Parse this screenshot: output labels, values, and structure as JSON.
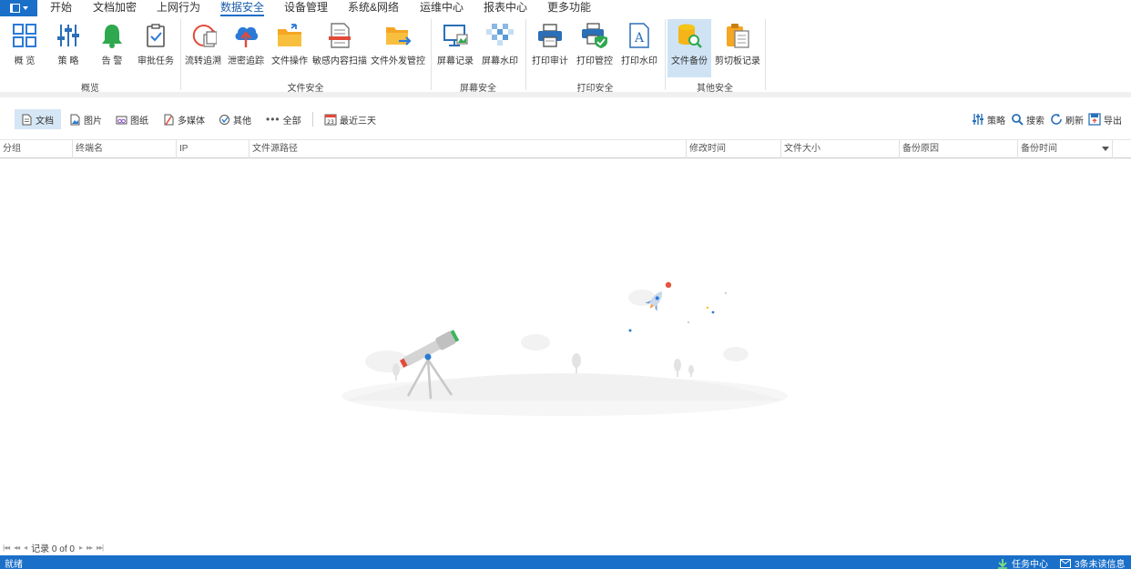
{
  "menubar": {
    "items": [
      "开始",
      "文档加密",
      "上网行为",
      "数据安全",
      "设备管理",
      "系统&网络",
      "运维中心",
      "报表中心",
      "更多功能"
    ],
    "active_index": 3
  },
  "ribbon": {
    "buttons": [
      "概 览",
      "策 略",
      "告 警",
      "审批任务",
      "流转追溯",
      "泄密追踪",
      "文件操作",
      "敏感内容扫描",
      "文件外发管控",
      "屏幕记录",
      "屏幕水印",
      "打印审计",
      "打印管控",
      "打印水印",
      "文件备份",
      "剪切板记录"
    ],
    "selected_index": 14,
    "groups": [
      "概览",
      "文件安全",
      "屏幕安全",
      "打印安全",
      "其他安全"
    ]
  },
  "filters": {
    "left": [
      "文档",
      "图片",
      "图纸",
      "多媒体",
      "其他",
      "全部"
    ],
    "date_range": "最近三天",
    "selected_index": 0,
    "right": [
      "策略",
      "搜索",
      "刷新",
      "导出"
    ]
  },
  "grid": {
    "columns": [
      "分组",
      "终端名",
      "IP",
      "文件源路径",
      "修改时间",
      "文件大小",
      "备份原因",
      "备份时间"
    ]
  },
  "pager": {
    "record_text": "记录 0 of 0"
  },
  "status": {
    "ready": "就绪",
    "task_center": "任务中心",
    "unread": "3条未读信息"
  },
  "colors": {
    "accent": "#1a6fc9",
    "selected_bg": "#cfe3f5",
    "status_bar": "#1a6fc9"
  }
}
